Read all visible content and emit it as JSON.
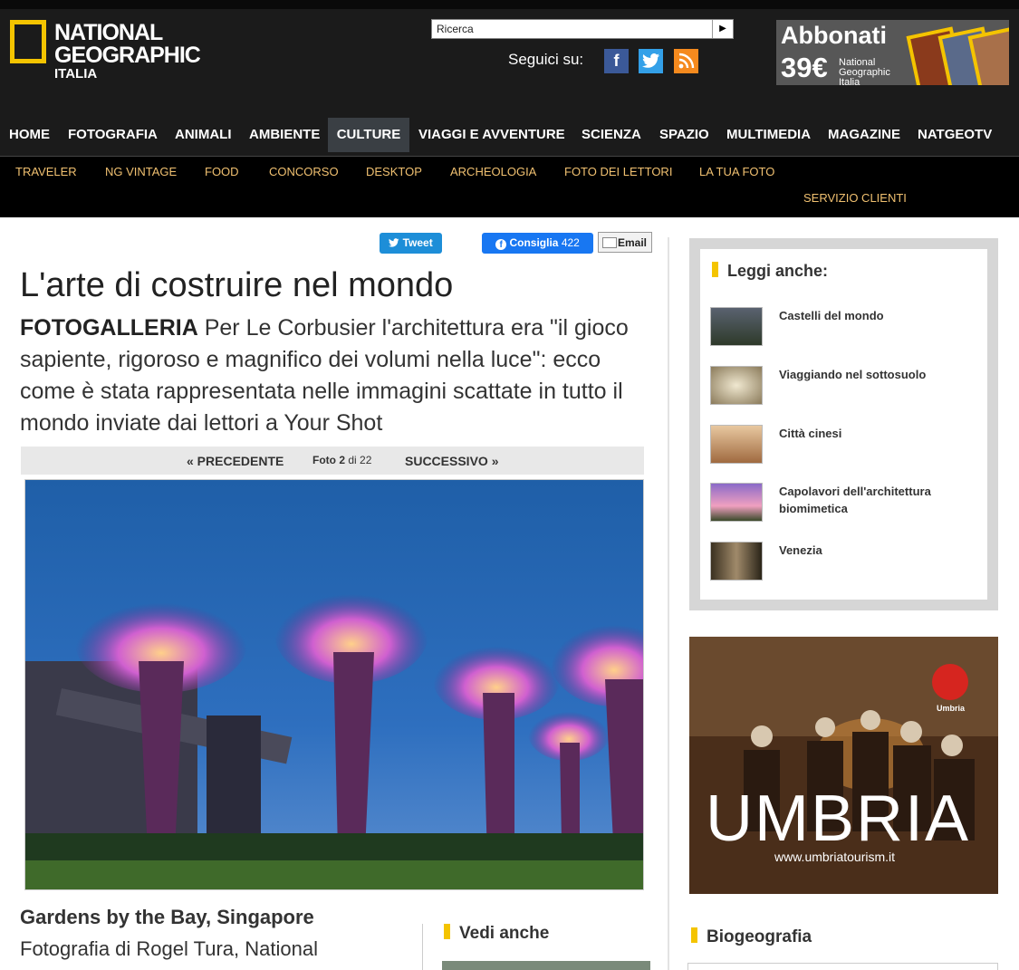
{
  "header": {
    "logo": {
      "line1": "NATIONAL",
      "line2": "GEOGRAPHIC",
      "line3": "ITALIA"
    },
    "search": {
      "value": "Ricerca",
      "go": "▶"
    },
    "follow_label": "Seguici su:",
    "social": [
      {
        "icon": "facebook-icon",
        "glyph": "f"
      },
      {
        "icon": "twitter-icon",
        "glyph": "🐦"
      },
      {
        "icon": "rss-icon",
        "glyph": "⊚"
      }
    ],
    "promo": {
      "title": "Abbonati",
      "price": "39€",
      "text": "National Geographic Italia"
    }
  },
  "nav": {
    "items": [
      "HOME",
      "FOTOGRAFIA",
      "ANIMALI",
      "AMBIENTE",
      "CULTURE",
      "VIAGGI E AVVENTURE",
      "SCIENZA",
      "SPAZIO",
      "MULTIMEDIA",
      "MAGAZINE",
      "NATGEOTV"
    ],
    "active": "CULTURE"
  },
  "subnav": {
    "items": [
      "TRAVELER",
      "NG VINTAGE",
      "FOOD",
      "CONCORSO",
      "DESKTOP",
      "ARCHEOLOGIA",
      "FOTO DEI LETTORI",
      "LA TUA FOTO",
      "SERVIZIO CLIENTI"
    ]
  },
  "share": {
    "tweet": "Tweet",
    "fb_label": "Consiglia",
    "fb_count": "422",
    "email": "Email"
  },
  "article": {
    "title": "L'arte di costruire nel mondo",
    "lede_kicker": "FOTOGALLERIA",
    "lede": "Per Le Corbusier l'architettura era \"il gioco sapiente, rigoroso e magnifico dei volumi nella luce\": ecco come è stata rappresentata nelle immagini scattate in tutto il mondo inviate dai lettori a Your Shot",
    "pager": {
      "prev": "« PRECEDENTE",
      "foto_label": "Foto 2",
      "of_label": "di 22",
      "next": "SUCCESSIVO »"
    },
    "caption_title": "Gardens by the Bay, Singapore",
    "caption_credit": "Fotografia di Rogel Tura, National",
    "vedi_anche": "Vedi anche"
  },
  "sidebar": {
    "heading": "Leggi anche:",
    "related": [
      {
        "title": "Castelli del mondo"
      },
      {
        "title": "Viaggiando nel sottosuolo"
      },
      {
        "title": "Città cinesi"
      },
      {
        "title": "Capolavori dell'architettura biomimetica"
      },
      {
        "title": "Venezia"
      }
    ],
    "ad": {
      "word": "UMBRIA",
      "url": "www.umbriatourism.it",
      "seal_text": "Umbria"
    },
    "biogeografia": "Biogeografia"
  },
  "colors": {
    "accent": "#f4c400",
    "nav_bg": "#1b1b1b",
    "subnav_text": "#f0c070",
    "fb": "#1877f2",
    "tweet": "#1d8ed8"
  }
}
